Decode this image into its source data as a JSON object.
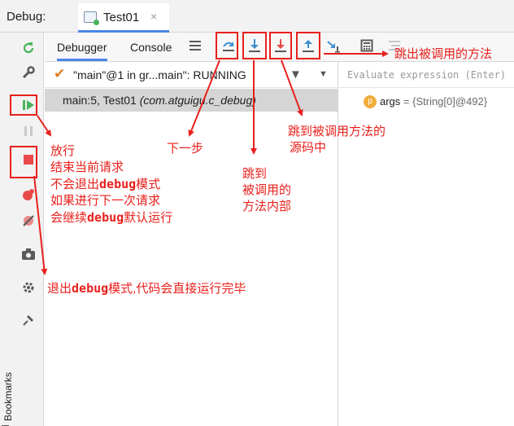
{
  "header": {
    "debug_label": "Debug:",
    "tab_name": "Test01",
    "tab_close": "×"
  },
  "debugger_toolbar": {
    "tabs": [
      "Debugger",
      "Console"
    ],
    "icons": [
      "hamburger-menu-icon",
      "step-over-icon",
      "step-into-icon",
      "force-step-into-icon",
      "step-out-icon",
      "run-to-cursor-icon",
      "evaluate-expression-icon",
      "trace-icon"
    ]
  },
  "left_toolbar": {
    "icons": [
      "rerun-icon",
      "wrench-icon",
      "resume-icon",
      "pause-icon",
      "stop-icon",
      "view-breakpoints-icon",
      "mute-breakpoints-icon",
      "camera-icon",
      "settings-icon",
      "pin-icon"
    ],
    "bookmarks_label": "Bookmarks"
  },
  "frames": {
    "thread_text": "\"main\"@1 in gr...main\": RUNNING",
    "frame_main": "main:5, Test01 ",
    "frame_location": "(com.atguigu.c_debug)"
  },
  "variables": {
    "eval_placeholder": "Evaluate expression (Enter)",
    "var_badge": "p",
    "var_name": "args",
    "var_value": " = {String[0]@492}"
  },
  "colors": {
    "accent": "#4a86e8",
    "annotation": "#e8201c",
    "resume": "#47b35a",
    "stop": "#e84a4a",
    "step_into": "#3e8ed0",
    "force_step_into": "#e84a4a"
  },
  "annotations": {
    "step_out": "跳出被调用的方法",
    "step_over": "下一步",
    "step_into": [
      "跳到",
      "被调用的",
      "方法内部"
    ],
    "force_step_into": [
      "跳到被调用方法的",
      "源码中"
    ],
    "resume": "放行",
    "resume_lines": [
      {
        "a": "结束当前请求",
        "b": "",
        "c": ""
      },
      {
        "a": "不会退出",
        "b": "debug",
        "c": "模式"
      },
      {
        "a": "如果进行下一次请求",
        "b": "",
        "c": ""
      },
      {
        "a": "会继续",
        "b": "debug",
        "c": "默认运行"
      }
    ],
    "stop": {
      "a": "退出",
      "b": "debug",
      "c": "模式,代码会直接运行完毕"
    }
  }
}
